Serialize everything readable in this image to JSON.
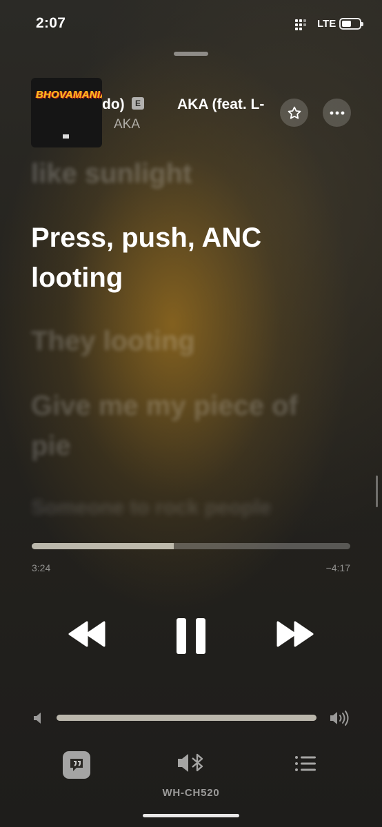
{
  "status_bar": {
    "time": "2:07",
    "network": "LTE",
    "icons": [
      "signal-icon",
      "battery-icon"
    ]
  },
  "now_playing": {
    "title_fragment": "do)",
    "explicit_badge": "E",
    "artist": "AKA",
    "title_scrolling": "AKA (feat. L-",
    "artwork_text": "BHOVAMANIA",
    "actions": [
      "star-icon",
      "more-icon"
    ]
  },
  "lyrics": {
    "previous_line": "like sunlight",
    "active_line": "Press, push, ANC looting",
    "next_lines": [
      "They looting",
      "Give me my piece of pie",
      "Someone to rock people"
    ]
  },
  "progress": {
    "elapsed": "3:24",
    "remaining": "−4:17",
    "fraction": 0.445
  },
  "controls": {
    "icons": [
      "rewind-icon",
      "pause-icon",
      "fast-forward-icon"
    ]
  },
  "volume": {
    "level": 1.0,
    "icons": [
      "speaker-low-icon",
      "speaker-high-icon"
    ]
  },
  "bottom_bar": {
    "device_name": "WH-CH520",
    "icons": [
      "lyrics-icon",
      "bluetooth-speaker-icon",
      "queue-icon"
    ]
  },
  "colors": {
    "accent_glow": "#a0731e",
    "background": "#1e1d1a",
    "artwork_text": "#f5c01e"
  }
}
